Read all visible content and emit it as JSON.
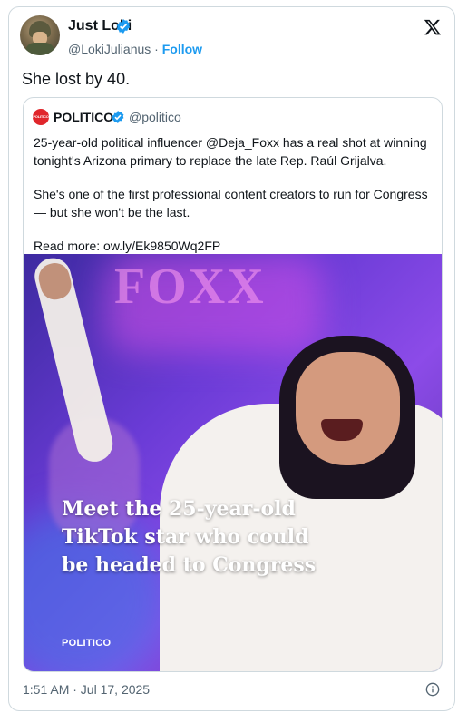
{
  "author": {
    "name": "Just Loki",
    "handle": "@LokiJulianus",
    "separator": " · ",
    "follow_label": "Follow"
  },
  "tweet": {
    "text": "She lost by 40."
  },
  "quote": {
    "logo_text": "POLITICO",
    "name": "POLITICO",
    "handle": "@politico",
    "paragraph1": "25-year-old political influencer @Deja_Foxx has a real shot at winning tonight's Arizona primary to replace the late Rep. Raúl Grijalva.",
    "paragraph2": "She's one of the first professional content creators to run for Congress — but she won't be the last.",
    "paragraph3": "Read more: ow.ly/Ek9850Wq2FP",
    "media": {
      "sign_text": "FOXX",
      "headline": "Meet the 25-year-old TikTok star who could be headed to Congress",
      "brand": "POLITICO"
    }
  },
  "footer": {
    "timestamp": "1:51 AM · Jul 17, 2025"
  },
  "colors": {
    "accent": "#1d9bf0",
    "politico_red": "#e0262b",
    "secondary_text": "#536471"
  }
}
